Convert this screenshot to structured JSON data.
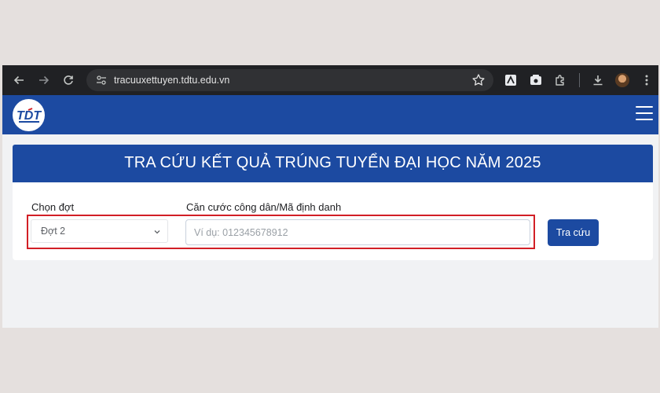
{
  "browser": {
    "url": "tracuuxettuyen.tdtu.edu.vn",
    "icons": [
      "back-arrow-icon",
      "forward-arrow-icon",
      "reload-icon",
      "site-info-icon",
      "bookmark-star-icon",
      "extension-icon",
      "extension-icon",
      "extensions-puzzle-icon",
      "download-icon",
      "profile-avatar",
      "more-vert-icon"
    ]
  },
  "header": {
    "logo_alt": "TDT",
    "menu_icon": "hamburger-menu-icon"
  },
  "page": {
    "title": "TRA CỨU KẾT QUẢ TRÚNG TUYỂN ĐẠI HỌC NĂM 2025"
  },
  "form": {
    "round_label": "Chọn đợt",
    "round_value": "Đợt 2",
    "id_label": "Căn cước công dân/Mã định danh",
    "id_value": "",
    "id_placeholder": "Ví dụ: 012345678912",
    "submit_label": "Tra cứu"
  },
  "colors": {
    "brand_blue": "#1c4aa1",
    "highlight_red": "#d21f26",
    "chrome_dark": "#202124"
  }
}
